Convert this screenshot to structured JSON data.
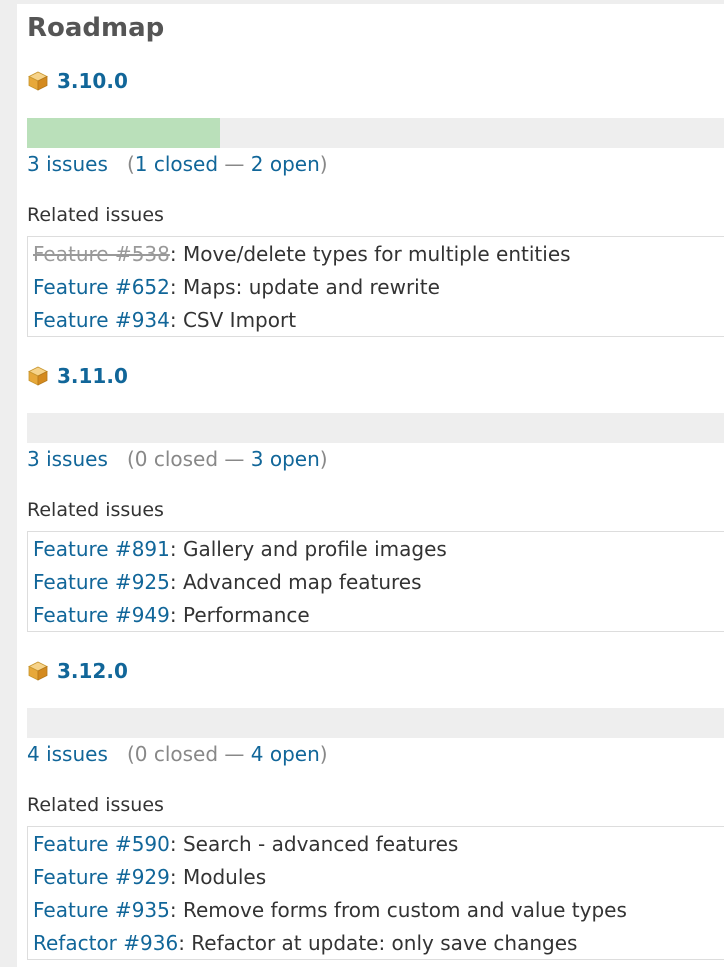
{
  "page": {
    "title": "Roadmap"
  },
  "versions": [
    {
      "name": "3.10.0",
      "progress_closed_fraction": 0.277,
      "issues_count_label": "3 issues",
      "closed_label": "1 closed",
      "open_label": "2 open",
      "related_label": "Related issues",
      "issues": [
        {
          "ref": "Feature #538",
          "subject": ": Move/delete types for multiple entities",
          "closed": true
        },
        {
          "ref": "Feature #652",
          "subject": ": Maps: update and rewrite",
          "closed": false
        },
        {
          "ref": "Feature #934",
          "subject": ": CSV Import",
          "closed": false
        }
      ]
    },
    {
      "name": "3.11.0",
      "progress_closed_fraction": 0,
      "issues_count_label": "3 issues",
      "closed_label": "0 closed",
      "open_label": "3 open",
      "related_label": "Related issues",
      "issues": [
        {
          "ref": "Feature #891",
          "subject": ": Gallery and profile images",
          "closed": false
        },
        {
          "ref": "Feature #925",
          "subject": ": Advanced map features",
          "closed": false
        },
        {
          "ref": "Feature #949",
          "subject": ": Performance",
          "closed": false
        }
      ]
    },
    {
      "name": "3.12.0",
      "progress_closed_fraction": 0,
      "issues_count_label": "4 issues",
      "closed_label": "0 closed",
      "open_label": "4 open",
      "related_label": "Related issues",
      "issues": [
        {
          "ref": "Feature #590",
          "subject": ": Search - advanced features",
          "closed": false
        },
        {
          "ref": "Feature #929",
          "subject": ": Modules",
          "closed": false
        },
        {
          "ref": "Feature #935",
          "subject": ": Remove forms from custom and value types",
          "closed": false
        },
        {
          "ref": "Refactor #936",
          "subject": ": Refactor at update: only save changes",
          "closed": false
        }
      ]
    }
  ],
  "icons": {
    "version": "package-icon"
  },
  "colors": {
    "link": "#116699",
    "progress_done": "#bae0ba",
    "progress_todo": "#eeeeee",
    "muted": "#888888"
  }
}
